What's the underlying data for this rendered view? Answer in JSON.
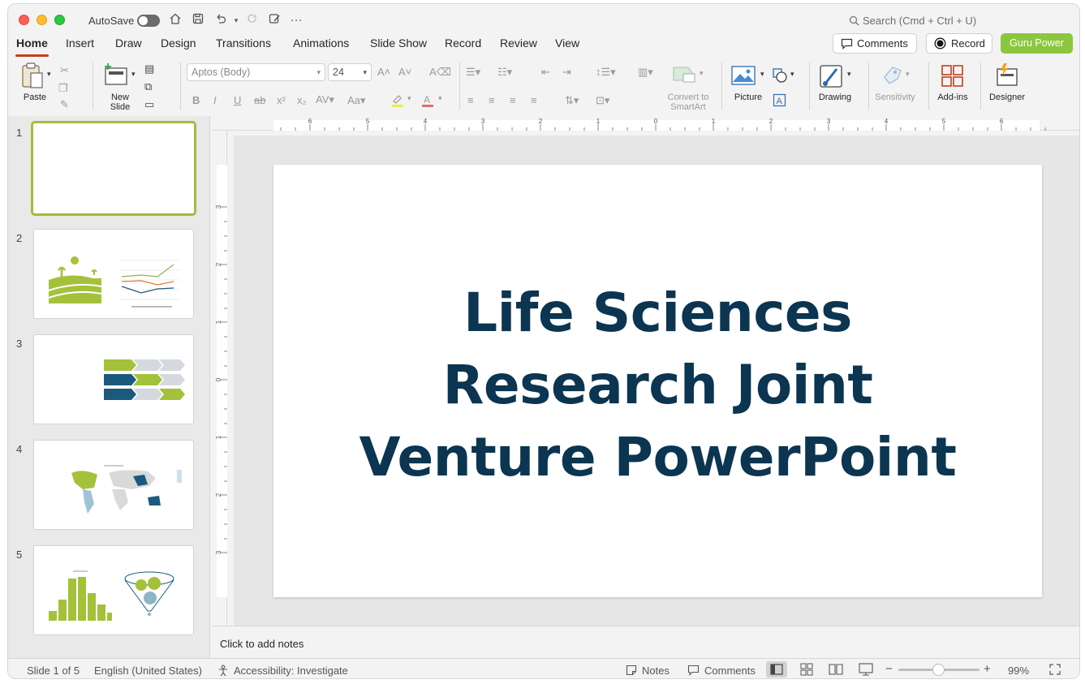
{
  "titlebar": {
    "autosave_label": "AutoSave",
    "search_placeholder": "Search (Cmd + Ctrl + U)"
  },
  "tabs": [
    {
      "label": "Home",
      "active": true
    },
    {
      "label": "Insert"
    },
    {
      "label": "Draw"
    },
    {
      "label": "Design"
    },
    {
      "label": "Transitions"
    },
    {
      "label": "Animations"
    },
    {
      "label": "Slide Show"
    },
    {
      "label": "Record"
    },
    {
      "label": "Review"
    },
    {
      "label": "View"
    }
  ],
  "header_buttons": {
    "comments": "Comments",
    "record": "Record",
    "guru": "Guru Power"
  },
  "ribbon": {
    "paste": "Paste",
    "new_slide_line1": "New",
    "new_slide_line2": "Slide",
    "font_name": "Aptos (Body)",
    "font_size": "24",
    "convert_line1": "Convert to",
    "convert_line2": "SmartArt",
    "picture": "Picture",
    "drawing": "Drawing",
    "sensitivity": "Sensitivity",
    "addins": "Add-ins",
    "designer": "Designer"
  },
  "thumbnails": [
    {
      "num": "1"
    },
    {
      "num": "2"
    },
    {
      "num": "3"
    },
    {
      "num": "4"
    },
    {
      "num": "5"
    }
  ],
  "slide": {
    "title_line1": "Life Sciences",
    "title_line2": "Research Joint",
    "title_line3": "Venture PowerPoint"
  },
  "ruler": {
    "h_ticks": [
      "6",
      "5",
      "4",
      "3",
      "2",
      "1",
      "0",
      "1",
      "2",
      "3",
      "4",
      "5",
      "6"
    ],
    "v_ticks": [
      "3",
      "2",
      "1",
      "0",
      "1",
      "2",
      "3"
    ]
  },
  "notes_placeholder": "Click to add notes",
  "status": {
    "slide_pos": "Slide 1 of 5",
    "language": "English (United States)",
    "accessibility": "Accessibility: Investigate",
    "notes": "Notes",
    "comments": "Comments",
    "zoom": "99%"
  },
  "colors": {
    "accent_tab": "#c43e1c",
    "guru_button": "#8cc63f",
    "title_text": "#0b3550",
    "thumb_green": "#a4c13a",
    "thumb_blue": "#1b5a7e"
  }
}
